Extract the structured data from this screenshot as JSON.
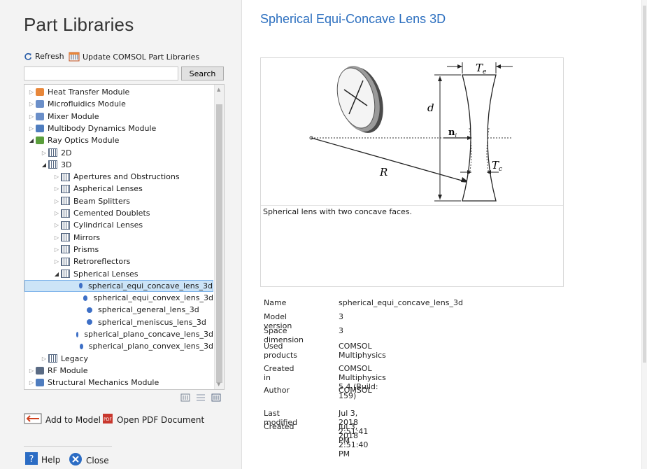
{
  "left": {
    "title": "Part Libraries",
    "toolbar": {
      "refresh_label": "Refresh",
      "update_label": "Update COMSOL Part Libraries"
    },
    "search": {
      "value": "",
      "button": "Search"
    },
    "tree": [
      {
        "label": "Heat Transfer Module",
        "level": 0,
        "state": "collapsed",
        "icon": "heat-transfer-icon"
      },
      {
        "label": "Microfluidics Module",
        "level": 0,
        "state": "collapsed",
        "icon": "microfluidics-icon"
      },
      {
        "label": "Mixer Module",
        "level": 0,
        "state": "collapsed",
        "icon": "mixer-icon"
      },
      {
        "label": "Multibody Dynamics Module",
        "level": 0,
        "state": "collapsed",
        "icon": "multibody-icon"
      },
      {
        "label": "Ray Optics Module",
        "level": 0,
        "state": "expanded",
        "icon": "ray-optics-icon"
      },
      {
        "label": "2D",
        "level": 1,
        "state": "collapsed",
        "icon": "library-icon"
      },
      {
        "label": "3D",
        "level": 1,
        "state": "expanded",
        "icon": "library-icon"
      },
      {
        "label": "Apertures and Obstructions",
        "level": 2,
        "state": "collapsed",
        "icon": "library-icon"
      },
      {
        "label": "Aspherical Lenses",
        "level": 2,
        "state": "collapsed",
        "icon": "library-icon"
      },
      {
        "label": "Beam Splitters",
        "level": 2,
        "state": "collapsed",
        "icon": "library-icon"
      },
      {
        "label": "Cemented Doublets",
        "level": 2,
        "state": "collapsed",
        "icon": "library-icon"
      },
      {
        "label": "Cylindrical Lenses",
        "level": 2,
        "state": "collapsed",
        "icon": "library-icon"
      },
      {
        "label": "Mirrors",
        "level": 2,
        "state": "collapsed",
        "icon": "library-icon"
      },
      {
        "label": "Prisms",
        "level": 2,
        "state": "collapsed",
        "icon": "library-icon"
      },
      {
        "label": "Retroreflectors",
        "level": 2,
        "state": "collapsed",
        "icon": "library-icon"
      },
      {
        "label": "Spherical Lenses",
        "level": 2,
        "state": "expanded",
        "icon": "library-icon"
      },
      {
        "label": "spherical_equi_concave_lens_3d",
        "level": 3,
        "state": "leaf",
        "icon": "part-dot-icon",
        "selected": true
      },
      {
        "label": "spherical_equi_convex_lens_3d",
        "level": 3,
        "state": "leaf",
        "icon": "part-dot-icon"
      },
      {
        "label": "spherical_general_lens_3d",
        "level": 3,
        "state": "leaf",
        "icon": "part-dot-icon"
      },
      {
        "label": "spherical_meniscus_lens_3d",
        "level": 3,
        "state": "leaf",
        "icon": "part-dot-icon"
      },
      {
        "label": "spherical_plano_concave_lens_3d",
        "level": 3,
        "state": "leaf",
        "icon": "part-dot-icon"
      },
      {
        "label": "spherical_plano_convex_lens_3d",
        "level": 3,
        "state": "leaf",
        "icon": "part-dot-icon"
      },
      {
        "label": "Legacy",
        "level": 1,
        "state": "collapsed",
        "icon": "library-icon"
      },
      {
        "label": "RF Module",
        "level": 0,
        "state": "collapsed",
        "icon": "rf-module-icon"
      },
      {
        "label": "Structural Mechanics Module",
        "level": 0,
        "state": "collapsed",
        "icon": "structural-mechanics-icon"
      }
    ],
    "actions": {
      "add_to_model": "Add to Model",
      "open_pdf": "Open PDF Document",
      "help": "Help",
      "close": "Close"
    }
  },
  "right": {
    "title": "Spherical Equi-Concave Lens 3D",
    "caption": "Spherical lens with two concave faces.",
    "figure_labels": {
      "Te": "T",
      "Te_sub": "e",
      "Tc": "T",
      "Tc_sub": "c",
      "d": "d",
      "R": "R",
      "ni": "n",
      "ni_sub": "i"
    },
    "metadata": [
      {
        "key": "Name",
        "value": "spherical_equi_concave_lens_3d"
      },
      {
        "key": "Model version",
        "value": "3"
      },
      {
        "key": "Space dimension",
        "value": "3"
      },
      {
        "key": "Used products",
        "value": "COMSOL Multiphysics"
      },
      {
        "key": "Created in",
        "value": "COMSOL Multiphysics 5.4 (Build: 159)"
      },
      {
        "key": "Author",
        "value": "COMSOL"
      },
      {
        "key": "Last modified",
        "value": "Jul 3, 2018 2:51:41 PM"
      },
      {
        "key": "Created",
        "value": "Jul 3, 2018 2:51:40 PM"
      }
    ]
  },
  "colors": {
    "accent": "#2c6fbf",
    "selection": "#cce4f7",
    "part_dot": "#3d6fc6"
  }
}
